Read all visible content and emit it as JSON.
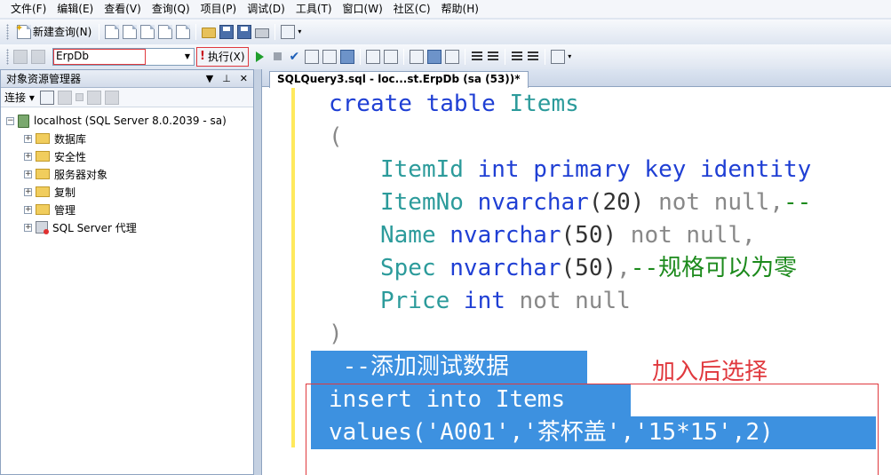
{
  "menu": [
    "文件(F)",
    "编辑(E)",
    "查看(V)",
    "查询(Q)",
    "项目(P)",
    "调试(D)",
    "工具(T)",
    "窗口(W)",
    "社区(C)",
    "帮助(H)"
  ],
  "toolbar": {
    "new_query": "新建查询(N)",
    "database": "ErpDb",
    "execute": "执行(X)"
  },
  "object_explorer": {
    "title": "对象资源管理器",
    "connect": "连接",
    "server": "localhost (SQL Server 8.0.2039 - sa)",
    "children": [
      "数据库",
      "安全性",
      "服务器对象",
      "复制",
      "管理",
      "SQL Server 代理"
    ]
  },
  "editor": {
    "tab_title": "SQLQuery3.sql - loc...st.ErpDb (sa (53))*",
    "annotation": "加入后选择",
    "lines": {
      "l1_kw": "create table ",
      "l1_tbl": "Items",
      "l2": "(",
      "l3_col": "ItemId ",
      "l3_kw": "int primary key identity",
      "l4_col": "ItemNo ",
      "l4_kw": "nvarchar",
      "l4_num": "(20)",
      "l4_rest": " not null,",
      "l4_cmt": "--",
      "l5_col": "Name ",
      "l5_kw": "nvarchar",
      "l5_num": "(50)",
      "l5_rest": " not null,",
      "l6_col": "Spec ",
      "l6_kw": "nvarchar",
      "l6_num": "(50)",
      "l6_rest": ",",
      "l6_cmt": "--规格可以为零",
      "l7_col": "Price ",
      "l7_kw": "int",
      "l7_rest": " not null",
      "l8": ")",
      "sel1": " --添加测试数据 ",
      "sel2": "insert into Items ",
      "sel3": "values('A001','茶杯盖','15*15',2)"
    }
  },
  "colors": {
    "selection": "#3d91e0",
    "highlight_box": "#e0393e",
    "keyword": "#1f3fd4",
    "table": "#2c9b9b",
    "comment": "#1c8a1c"
  }
}
